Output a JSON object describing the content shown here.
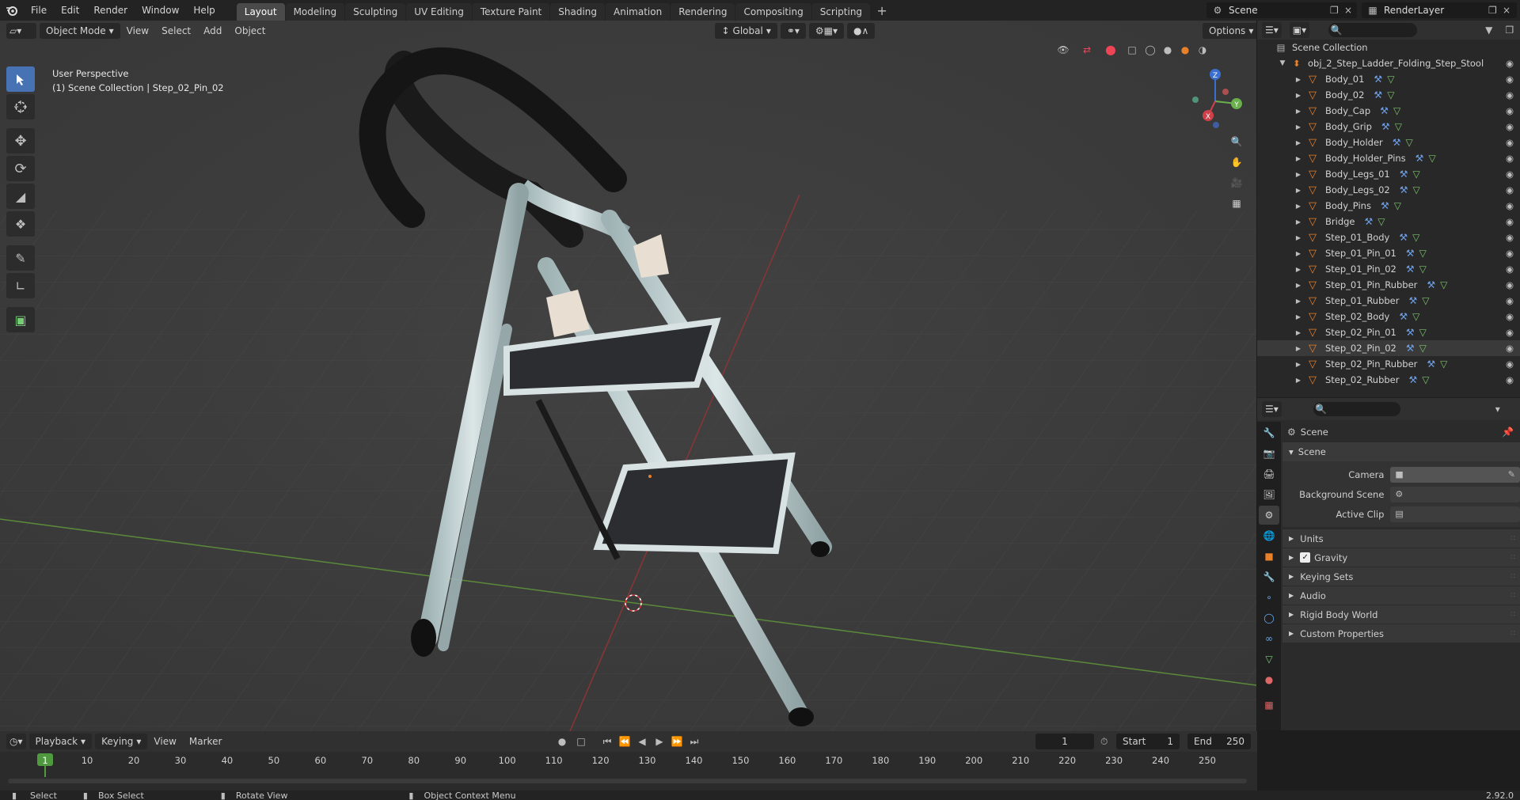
{
  "menu": [
    "File",
    "Edit",
    "Render",
    "Window",
    "Help"
  ],
  "workspaces": [
    "Layout",
    "Modeling",
    "Sculpting",
    "UV Editing",
    "Texture Paint",
    "Shading",
    "Animation",
    "Rendering",
    "Compositing",
    "Scripting"
  ],
  "active_workspace": "Layout",
  "scene_selector": "Scene",
  "render_layer": "RenderLayer",
  "viewport": {
    "mode": "Object Mode",
    "menus": [
      "View",
      "Select",
      "Add",
      "Object"
    ],
    "transform_orientation": "Global",
    "options_label": "Options",
    "perspective_label": "User Perspective",
    "collection_label": "(1) Scene Collection | Step_02_Pin_02",
    "gizmo": {
      "x": "X",
      "y": "Y",
      "z": "Z"
    }
  },
  "outliner": {
    "root": "Scene Collection",
    "object": "obj_2_Step_Ladder_Folding_Step_Stool",
    "items": [
      "Body_01",
      "Body_02",
      "Body_Cap",
      "Body_Grip",
      "Body_Holder",
      "Body_Holder_Pins",
      "Body_Legs_01",
      "Body_Legs_02",
      "Body_Pins",
      "Bridge",
      "Step_01_Body",
      "Step_01_Pin_01",
      "Step_01_Pin_02",
      "Step_01_Pin_Rubber",
      "Step_01_Rubber",
      "Step_02_Body",
      "Step_02_Pin_01",
      "Step_02_Pin_02",
      "Step_02_Pin_Rubber",
      "Step_02_Rubber"
    ],
    "highlighted": "Step_02_Pin_02"
  },
  "properties": {
    "context": "Scene",
    "panel": "Scene",
    "fields": [
      {
        "label": "Camera"
      },
      {
        "label": "Background Scene"
      },
      {
        "label": "Active Clip"
      }
    ],
    "subpanels": [
      "Units",
      "Gravity",
      "Keying Sets",
      "Audio",
      "Rigid Body World",
      "Custom Properties"
    ],
    "gravity_checked": true
  },
  "timeline": {
    "menus": [
      "Playback",
      "Keying",
      "View",
      "Marker"
    ],
    "current_frame": "1",
    "start_label": "Start",
    "start": "1",
    "end_label": "End",
    "end": "250",
    "ticks": [
      "1",
      "10",
      "20",
      "30",
      "40",
      "50",
      "60",
      "70",
      "80",
      "90",
      "100",
      "110",
      "120",
      "130",
      "140",
      "150",
      "160",
      "170",
      "180",
      "190",
      "200",
      "210",
      "220",
      "230",
      "240",
      "250"
    ]
  },
  "status": {
    "select": "Select",
    "box_select": "Box Select",
    "rotate": "Rotate View",
    "context_menu": "Object Context Menu",
    "version": "2.92.0"
  },
  "colors": {
    "accent": "#4772b3",
    "orange": "#e8812a",
    "selected_row": "#334d80"
  }
}
